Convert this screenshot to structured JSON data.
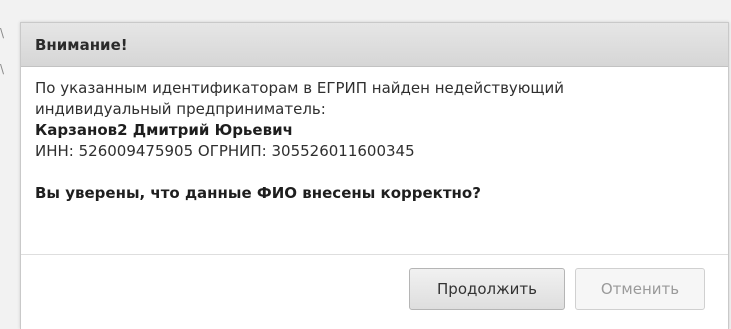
{
  "dialog": {
    "title": "Внимание!",
    "message_line1": "По указанным идентификаторам в ЕГРИП найден недействующий",
    "message_line2": "индивидуальный предприниматель:",
    "person_name": "Карзанов2 Дмитрий Юрьевич",
    "identifiers": "ИНН: 526009475905 ОГРНИП: 305526011600345",
    "question": "Вы уверены, что данные ФИО внесены корректно?",
    "continue_label": "Продолжить",
    "cancel_label": "Отменить"
  },
  "colors": {
    "header_bg": "#dcdcdc",
    "button_primary_bg": "#e6e6e6",
    "button_disabled_text": "#9a9a9a"
  }
}
